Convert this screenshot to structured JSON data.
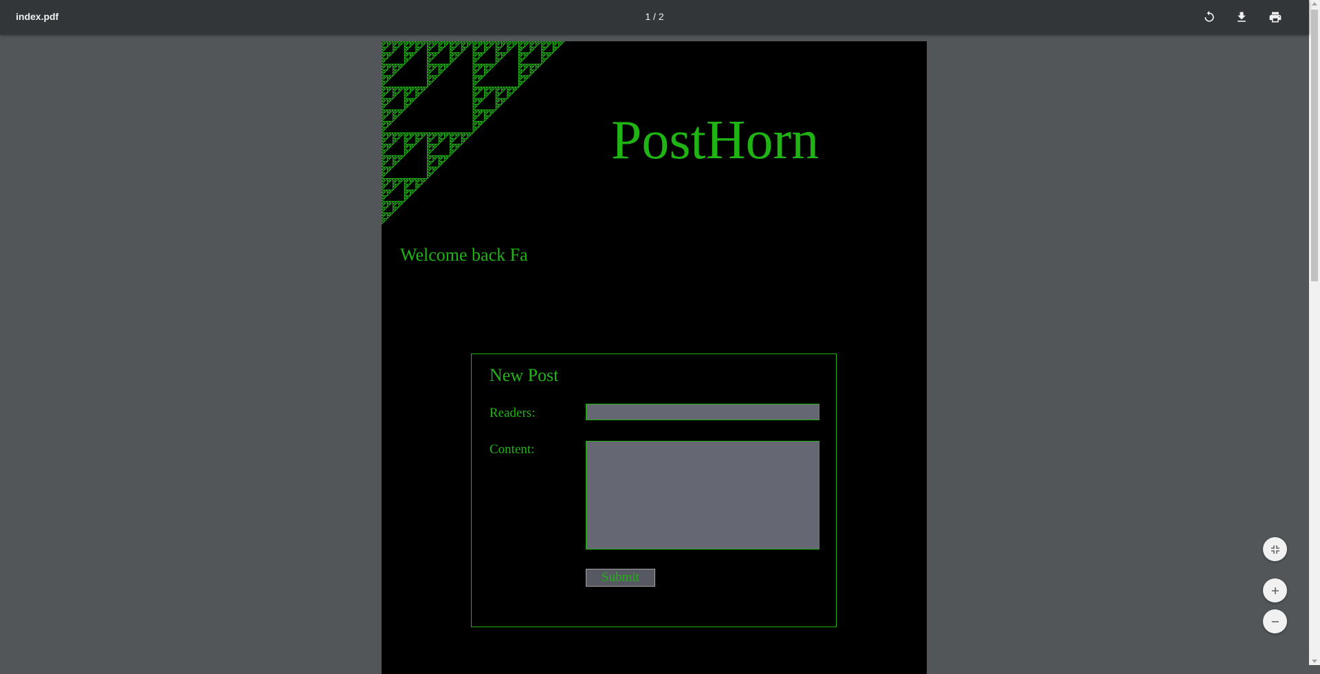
{
  "viewer": {
    "file_name": "index.pdf",
    "page_indicator": "1 / 2",
    "icons": {
      "rotate": "rotate-icon",
      "download": "download-icon",
      "print": "print-icon",
      "fit": "fit-to-page-icon",
      "zoom_in": "zoom-in-icon",
      "zoom_out": "zoom-out-icon"
    }
  },
  "page": {
    "site_title": "PostHorn",
    "welcome": "Welcome back Fa",
    "new_post": {
      "heading": "New Post",
      "readers_label": "Readers:",
      "readers_value": "",
      "content_label": "Content:",
      "content_value": "",
      "submit_label": "Submit"
    }
  },
  "colors": {
    "viewer_background": "#525659",
    "toolbar": "#323639",
    "page_background": "#000000",
    "accent_green": "#1fb414",
    "input_fill": "#656873"
  }
}
